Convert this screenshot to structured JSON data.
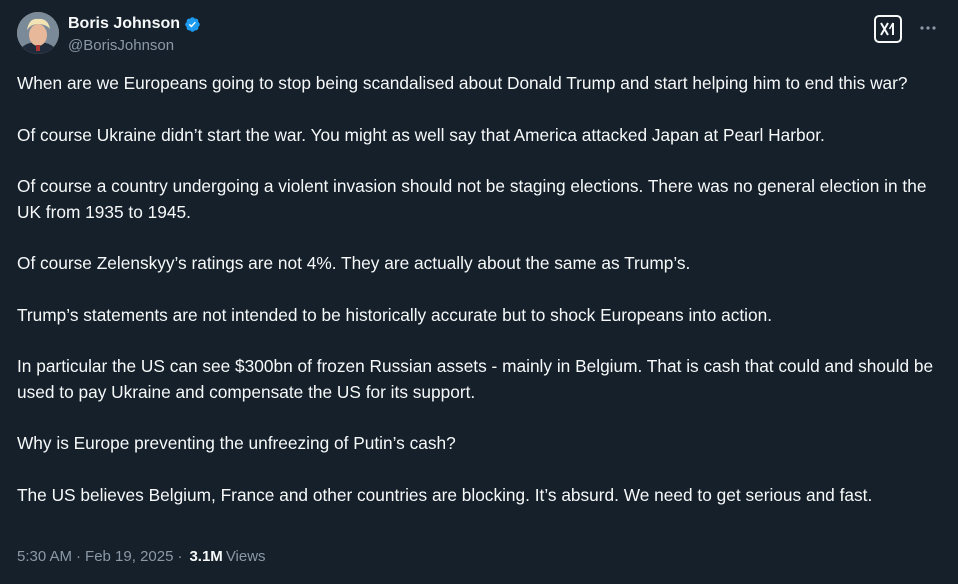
{
  "author": {
    "name": "Boris Johnson",
    "handle": "@BorisJohnson",
    "verified_icon": "verified-badge-icon"
  },
  "actions": {
    "grok_icon": "grok-icon",
    "more_icon": "more-options-icon"
  },
  "tweet": {
    "paragraphs": [
      "When are we Europeans going to stop being scandalised about Donald Trump and start helping him to end this war?",
      "Of course Ukraine didn’t start the war. You might as well say that America attacked Japan at Pearl Harbor.",
      "Of course a country undergoing a violent invasion should not be staging elections. There was no general election in the UK from 1935 to 1945.",
      "Of course Zelenskyy’s ratings are not 4%. They are actually about the same as Trump’s.",
      "Trump’s statements are not intended to be historically accurate but to shock Europeans into action.",
      "In particular the US can see $300bn of frozen Russian assets - mainly in Belgium. That is cash that could and should be used to pay Ukraine and compensate the US for its support.",
      "Why is Europe preventing the unfreezing of Putin’s cash?",
      "The US believes Belgium, France and other countries are blocking. It’s absurd. We need to get serious and fast."
    ]
  },
  "meta": {
    "time": "5:30 AM",
    "separator": "·",
    "date": "Feb 19, 2025",
    "views_count": "3.1M",
    "views_label": "Views"
  },
  "colors": {
    "background": "#15202b",
    "text": "#f7f9f9",
    "secondary": "#8b98a5",
    "verified": "#1d9bf0"
  }
}
